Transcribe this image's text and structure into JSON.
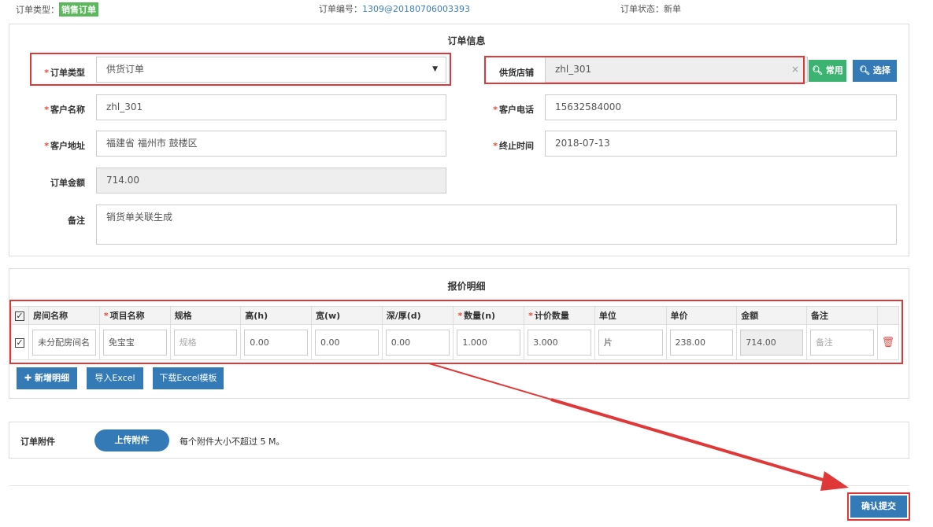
{
  "header": {
    "order_type_label": "订单类型：",
    "order_type_value": "销售订单",
    "order_no_label": "订单编号：",
    "order_no_value": "1309@20180706003393",
    "order_status_label": "订单状态：",
    "order_status_value": "新单"
  },
  "order_info": {
    "title": "订单信息",
    "order_type": {
      "label": "订单类型",
      "value": "供货订单"
    },
    "supplier_shop": {
      "label": "供货店铺",
      "value": "zhl_301",
      "clear_icon": "×",
      "common_button": "常用",
      "select_button": "选择"
    },
    "customer_name": {
      "label": "客户名称",
      "value": "zhl_301"
    },
    "customer_phone": {
      "label": "客户电话",
      "value": "15632584000"
    },
    "customer_address": {
      "label": "客户地址",
      "value": "福建省 福州市 鼓楼区"
    },
    "end_time": {
      "label": "终止时间",
      "value": "2018-07-13"
    },
    "order_amount": {
      "label": "订单金额",
      "value": "714.00"
    },
    "remark": {
      "label": "备注",
      "value": "销货单关联生成"
    },
    "required_mark": "*"
  },
  "quote": {
    "title": "报价明细",
    "columns": [
      "房间名称",
      "项目名称",
      "规格",
      "高(h)",
      "宽(w)",
      "深/厚(d)",
      "数量(n)",
      "计价数量",
      "单位",
      "单价",
      "金额",
      "备注"
    ],
    "required_columns": [
      1,
      6,
      7
    ],
    "rows": [
      {
        "room": "未分配房间名",
        "item": "免宝宝",
        "spec_placeholder": "规格",
        "height": "0.00",
        "width": "0.00",
        "depth": "0.00",
        "quantity": "1.000",
        "pricing_quantity": "3.000",
        "unit": "片",
        "unit_price": "238.00",
        "amount": "714.00",
        "remark_placeholder": "备注"
      }
    ],
    "buttons": {
      "add": "新增明细",
      "import": "导入Excel",
      "download": "下载Excel模板"
    }
  },
  "attachment": {
    "label": "订单附件",
    "upload_button": "上传附件",
    "hint": "每个附件大小不超过 5 M。"
  },
  "submit_button": "确认提交",
  "annotation_color": "#e03838"
}
